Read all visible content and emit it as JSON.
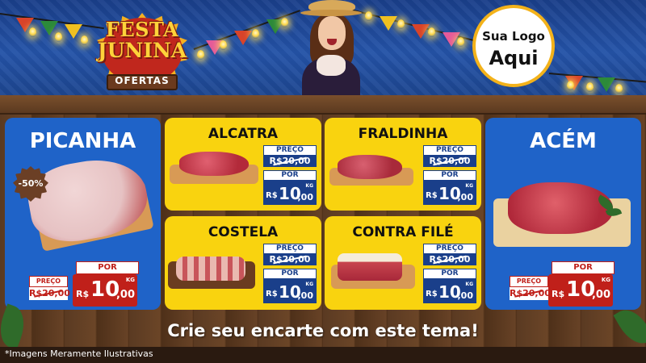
{
  "logo": {
    "line1": "FESTA",
    "line2": "JUNINA",
    "ribbon": "OFERTAS"
  },
  "your_logo": {
    "line1": "Sua Logo",
    "line2": "Aqui"
  },
  "cards": {
    "picanha": {
      "title": "PICANHA",
      "badge": "-50%",
      "preco_label": "PREÇO",
      "old_price": "R$20,00",
      "por_label": "POR",
      "currency": "R$",
      "price_int": "10",
      "price_dec": ",00",
      "unit": "KG"
    },
    "alcatra": {
      "title": "ALCATRA",
      "preco_label": "PREÇO",
      "old_price": "R$20,00",
      "por_label": "POR",
      "currency": "R$",
      "price_int": "10",
      "price_dec": ",00",
      "unit": "KG"
    },
    "fraldinha": {
      "title": "FRALDINHA",
      "preco_label": "PREÇO",
      "old_price": "R$20,00",
      "por_label": "POR",
      "currency": "R$",
      "price_int": "10",
      "price_dec": ",00",
      "unit": "KG"
    },
    "costela": {
      "title": "COSTELA",
      "preco_label": "PREÇO",
      "old_price": "R$20,00",
      "por_label": "POR",
      "currency": "R$",
      "price_int": "10",
      "price_dec": ",00",
      "unit": "KG"
    },
    "contrafile": {
      "title": "CONTRA FILÉ",
      "preco_label": "PREÇO",
      "old_price": "R$20,00",
      "por_label": "POR",
      "currency": "R$",
      "price_int": "10",
      "price_dec": ",00",
      "unit": "KG"
    },
    "acem": {
      "title": "ACÉM",
      "preco_label": "PREÇO",
      "old_price": "R$20,00",
      "por_label": "POR",
      "currency": "R$",
      "price_int": "10",
      "price_dec": ",00",
      "unit": "KG"
    }
  },
  "banner": "Crie seu encarte com este tema!",
  "footer": "*Imagens Meramente Ilustrativas",
  "colors": {
    "blue_card": "#1f63c8",
    "yellow_card": "#f9d30f",
    "price_blue": "#1a3f8a",
    "price_red": "#c0201a"
  }
}
